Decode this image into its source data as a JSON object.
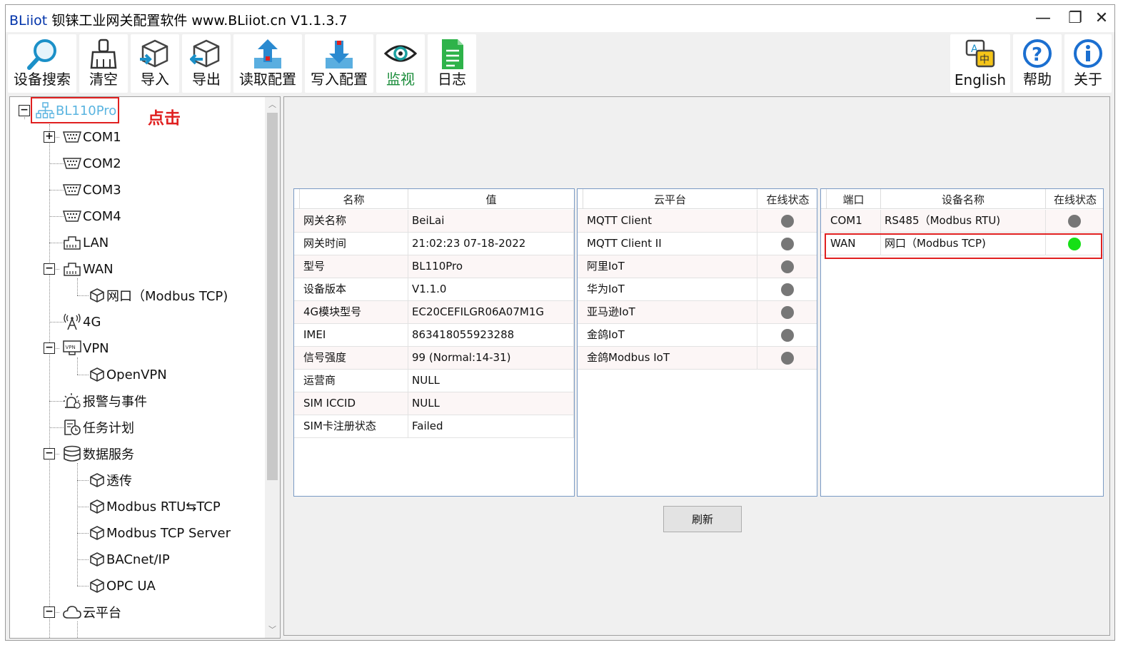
{
  "window": {
    "title_brand": "BLiiot",
    "title_rest": "钡铼工业网关配置软件 www.BLiiot.cn V1.1.3.7",
    "minimize": "—",
    "maximize": "❐",
    "close": "✕"
  },
  "toolbar": {
    "search": "设备搜索",
    "clear": "清空",
    "import": "导入",
    "export": "导出",
    "read_config": "读取配置",
    "write_config": "写入配置",
    "monitor": "监视",
    "log": "日志",
    "english": "English",
    "help": "帮助",
    "about": "关于",
    "monitor_color": "#1a8c3a"
  },
  "tree": {
    "root": "BL110Pro",
    "click_hint": "点击",
    "items": {
      "com1": "COM1",
      "com2": "COM2",
      "com3": "COM3",
      "com4": "COM4",
      "lan": "LAN",
      "wan": "WAN",
      "wan_child": "网口（Modbus TCP)",
      "g4": "4G",
      "vpn": "VPN",
      "openvpn": "OpenVPN",
      "alarm": "报警与事件",
      "task": "任务计划",
      "data_service": "数据服务",
      "transparent": "透传",
      "rtu_tcp": "Modbus RTU⇆TCP",
      "tcp_server": "Modbus TCP Server",
      "bacnet": "BACnet/IP",
      "opcua": "OPC UA",
      "cloud": "云平台"
    }
  },
  "info_table": {
    "headers": [
      "名称",
      "值"
    ],
    "rows": [
      [
        "网关名称",
        "BeiLai"
      ],
      [
        "网关时间",
        "21:02:23 07-18-2022"
      ],
      [
        "型号",
        "BL110Pro"
      ],
      [
        "设备版本",
        "V1.1.0"
      ],
      [
        "4G模块型号",
        "EC20CEFILGR06A07M1G"
      ],
      [
        "IMEI",
        "863418055923288"
      ],
      [
        "信号强度",
        "99 (Normal:14-31)"
      ],
      [
        "运营商",
        "NULL"
      ],
      [
        "SIM ICCID",
        "NULL"
      ],
      [
        "SIM卡注册状态",
        "Failed"
      ]
    ]
  },
  "cloud_table": {
    "headers": [
      "云平台",
      "在线状态"
    ],
    "rows": [
      "MQTT Client",
      "MQTT Client II",
      "阿里IoT",
      "华为IoT",
      "亚马逊IoT",
      "金鸽IoT",
      "金鸽Modbus IoT"
    ],
    "offline_color": "#777777"
  },
  "port_table": {
    "headers": [
      "端口",
      "设备名称",
      "在线状态"
    ],
    "rows": [
      [
        "COM1",
        "RS485（Modbus RTU)"
      ],
      [
        "WAN",
        "网口（Modbus TCP)"
      ]
    ],
    "status_colors": [
      "#777777",
      "#16e016"
    ]
  },
  "refresh_button": "刷新"
}
